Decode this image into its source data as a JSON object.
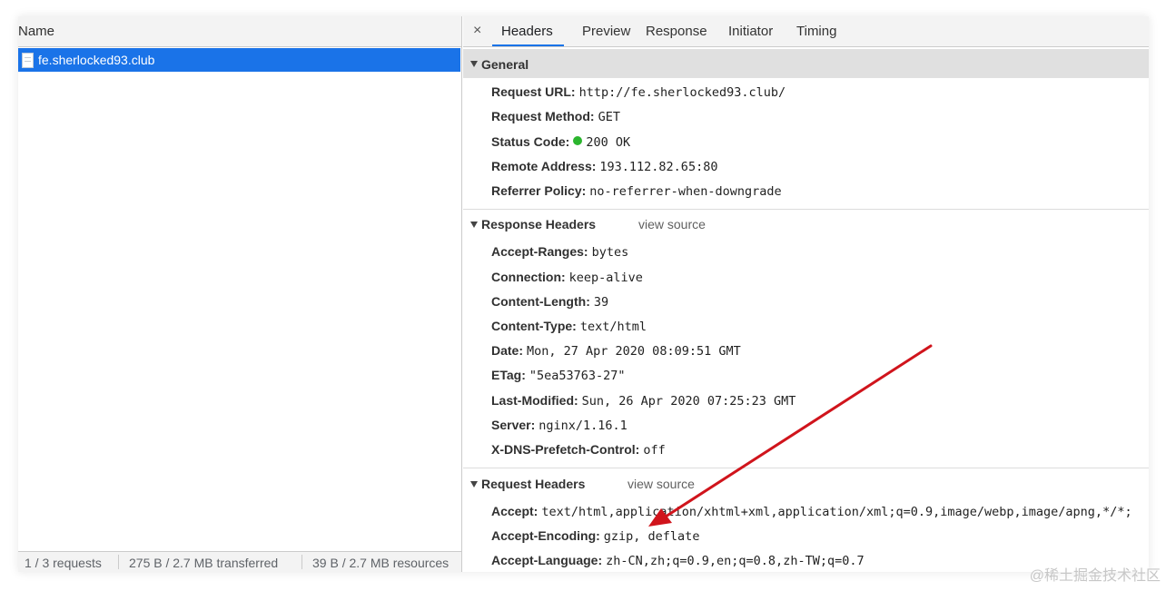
{
  "left_panel": {
    "column_header": "Name",
    "selected_request": "fe.sherlocked93.club",
    "status": {
      "requests": "1 / 3 requests",
      "transferred": "275 B / 2.7 MB transferred",
      "resources": "39 B / 2.7 MB resources"
    }
  },
  "tabs": {
    "close": "×",
    "items": [
      "Headers",
      "Preview",
      "Response",
      "Initiator",
      "Timing"
    ],
    "active": "Headers"
  },
  "general": {
    "title": "General",
    "rows": [
      {
        "key": "Request URL:",
        "value": "http://fe.sherlocked93.club/"
      },
      {
        "key": "Request Method:",
        "value": "GET"
      },
      {
        "key": "Status Code:",
        "value": "200 OK"
      },
      {
        "key": "Remote Address:",
        "value": "193.112.82.65:80"
      },
      {
        "key": "Referrer Policy:",
        "value": "no-referrer-when-downgrade"
      }
    ]
  },
  "response_headers": {
    "title": "Response Headers",
    "view_source": "view source",
    "rows": [
      {
        "key": "Accept-Ranges:",
        "value": "bytes"
      },
      {
        "key": "Connection:",
        "value": "keep-alive"
      },
      {
        "key": "Content-Length:",
        "value": "39"
      },
      {
        "key": "Content-Type:",
        "value": "text/html"
      },
      {
        "key": "Date:",
        "value": "Mon, 27 Apr 2020 08:09:51 GMT"
      },
      {
        "key": "ETag:",
        "value": "\"5ea53763-27\""
      },
      {
        "key": "Last-Modified:",
        "value": "Sun, 26 Apr 2020 07:25:23 GMT"
      },
      {
        "key": "Server:",
        "value": "nginx/1.16.1"
      },
      {
        "key": "X-DNS-Prefetch-Control:",
        "value": "off"
      }
    ]
  },
  "request_headers": {
    "title": "Request Headers",
    "view_source": "view source",
    "rows": [
      {
        "key": "Accept:",
        "value": "text/html,application/xhtml+xml,application/xml;q=0.9,image/webp,image/apng,*/*;"
      },
      {
        "key": "Accept-Encoding:",
        "value": "gzip, deflate"
      },
      {
        "key": "Accept-Language:",
        "value": "zh-CN,zh;q=0.9,en;q=0.8,zh-TW;q=0.7"
      }
    ]
  },
  "colors": {
    "selection": "#1a73e8",
    "status_ok": "#2bb52e",
    "annotation_arrow": "#d0141c"
  },
  "watermark": "@稀土掘金技术社区"
}
